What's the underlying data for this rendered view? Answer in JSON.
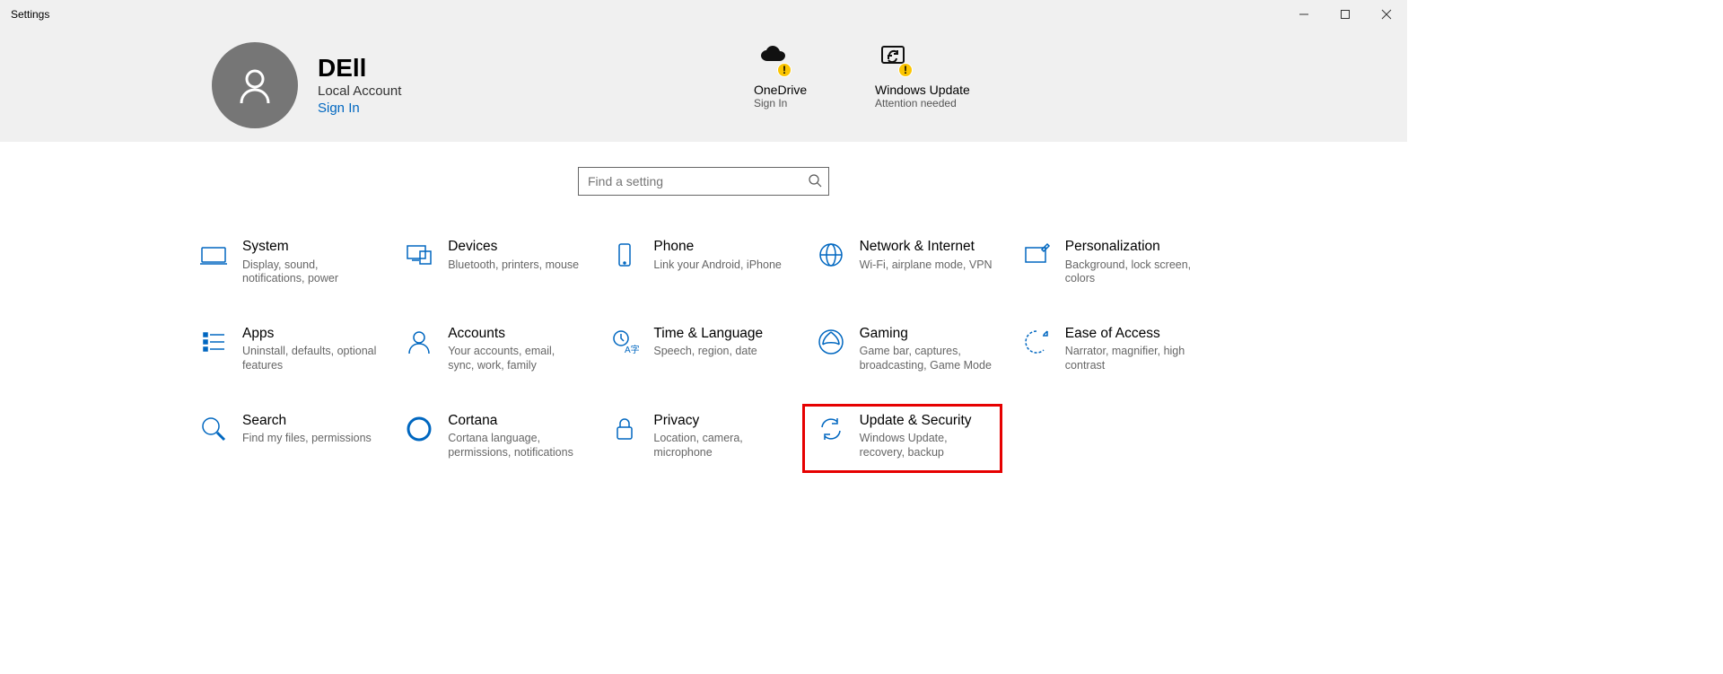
{
  "window": {
    "title": "Settings"
  },
  "user": {
    "name": "DEll",
    "subtitle": "Local Account",
    "signin": "Sign In"
  },
  "status": {
    "onedrive": {
      "title": "OneDrive",
      "sub": "Sign In"
    },
    "update": {
      "title": "Windows Update",
      "sub": "Attention needed"
    }
  },
  "search": {
    "placeholder": "Find a setting"
  },
  "tiles": {
    "system": {
      "title": "System",
      "desc": "Display, sound, notifications, power"
    },
    "devices": {
      "title": "Devices",
      "desc": "Bluetooth, printers, mouse"
    },
    "phone": {
      "title": "Phone",
      "desc": "Link your Android, iPhone"
    },
    "network": {
      "title": "Network & Internet",
      "desc": "Wi-Fi, airplane mode, VPN"
    },
    "personal": {
      "title": "Personalization",
      "desc": "Background, lock screen, colors"
    },
    "apps": {
      "title": "Apps",
      "desc": "Uninstall, defaults, optional features"
    },
    "accounts": {
      "title": "Accounts",
      "desc": "Your accounts, email, sync, work, family"
    },
    "time": {
      "title": "Time & Language",
      "desc": "Speech, region, date"
    },
    "gaming": {
      "title": "Gaming",
      "desc": "Game bar, captures, broadcasting, Game Mode"
    },
    "ease": {
      "title": "Ease of Access",
      "desc": "Narrator, magnifier, high contrast"
    },
    "search": {
      "title": "Search",
      "desc": "Find my files, permissions"
    },
    "cortana": {
      "title": "Cortana",
      "desc": "Cortana language, permissions, notifications"
    },
    "privacy": {
      "title": "Privacy",
      "desc": "Location, camera, microphone"
    },
    "update": {
      "title": "Update & Security",
      "desc": "Windows Update, recovery, backup"
    }
  }
}
